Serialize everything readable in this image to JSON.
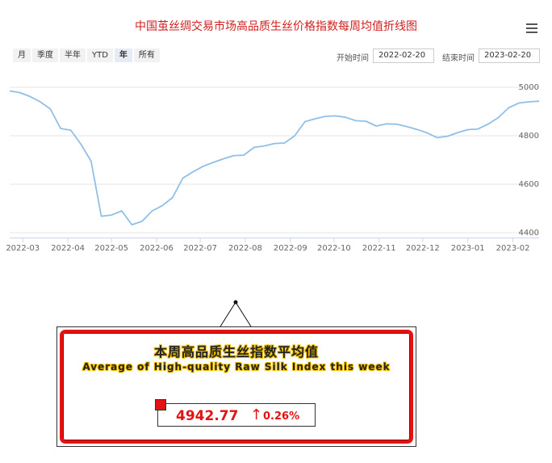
{
  "header": {
    "title": "中国茧丝绸交易市场高品质生丝价格指数每周均值折线图"
  },
  "range_buttons": [
    {
      "label": "月",
      "active": false
    },
    {
      "label": "季度",
      "active": false
    },
    {
      "label": "半年",
      "active": false
    },
    {
      "label": "YTD",
      "active": false
    },
    {
      "label": "年",
      "active": true
    },
    {
      "label": "所有",
      "active": false
    }
  ],
  "date_range": {
    "start_label": "开始时间",
    "start_value": "2022-02-20",
    "end_label": "结束时间",
    "end_value": "2023-02-20"
  },
  "colors": {
    "line": "#90bfe8",
    "title": "#d11f1f",
    "accent": "#e31313"
  },
  "chart_data": {
    "type": "line",
    "ylim": [
      4380,
      5060
    ],
    "yticks": [
      4400,
      4600,
      4800,
      5000
    ],
    "grid": true,
    "xtick_labels": [
      "2022-03",
      "2022-04",
      "2022-05",
      "2022-06",
      "2022-07",
      "2022-08",
      "2022-09",
      "2022-10",
      "2022-11",
      "2022-12",
      "2023-01",
      "2023-02"
    ],
    "x": [
      "2022-02-20",
      "2022-02-27",
      "2022-03-06",
      "2022-03-13",
      "2022-03-20",
      "2022-03-27",
      "2022-04-03",
      "2022-04-10",
      "2022-04-17",
      "2022-04-24",
      "2022-05-01",
      "2022-05-08",
      "2022-05-15",
      "2022-05-22",
      "2022-05-29",
      "2022-06-05",
      "2022-06-12",
      "2022-06-19",
      "2022-06-26",
      "2022-07-03",
      "2022-07-10",
      "2022-07-17",
      "2022-07-24",
      "2022-07-31",
      "2022-08-07",
      "2022-08-14",
      "2022-08-21",
      "2022-08-28",
      "2022-09-04",
      "2022-09-11",
      "2022-09-18",
      "2022-09-25",
      "2022-10-02",
      "2022-10-09",
      "2022-10-16",
      "2022-10-23",
      "2022-10-30",
      "2022-11-06",
      "2022-11-13",
      "2022-11-20",
      "2022-11-27",
      "2022-12-04",
      "2022-12-11",
      "2022-12-18",
      "2022-12-25",
      "2023-01-01",
      "2023-01-08",
      "2023-01-15",
      "2023-01-22",
      "2023-01-29",
      "2023-02-05",
      "2023-02-12",
      "2023-02-19"
    ],
    "values": [
      4985,
      4978,
      4962,
      4940,
      4910,
      4830,
      4823,
      4765,
      4695,
      4468,
      4473,
      4490,
      4433,
      4447,
      4490,
      4512,
      4545,
      4625,
      4651,
      4674,
      4690,
      4705,
      4718,
      4720,
      4752,
      4758,
      4768,
      4770,
      4800,
      4858,
      4870,
      4880,
      4882,
      4876,
      4862,
      4860,
      4840,
      4849,
      4848,
      4838,
      4826,
      4812,
      4792,
      4798,
      4813,
      4825,
      4828,
      4848,
      4875,
      4915,
      4935,
      4940,
      4942.77
    ]
  },
  "summary_panel": {
    "title_cn": "本周高品质生丝指数平均值",
    "title_en": "Average of High-quality Raw Silk Index this week",
    "value": "4942.77",
    "arrow": "↑",
    "change_pct": "0.26%"
  }
}
